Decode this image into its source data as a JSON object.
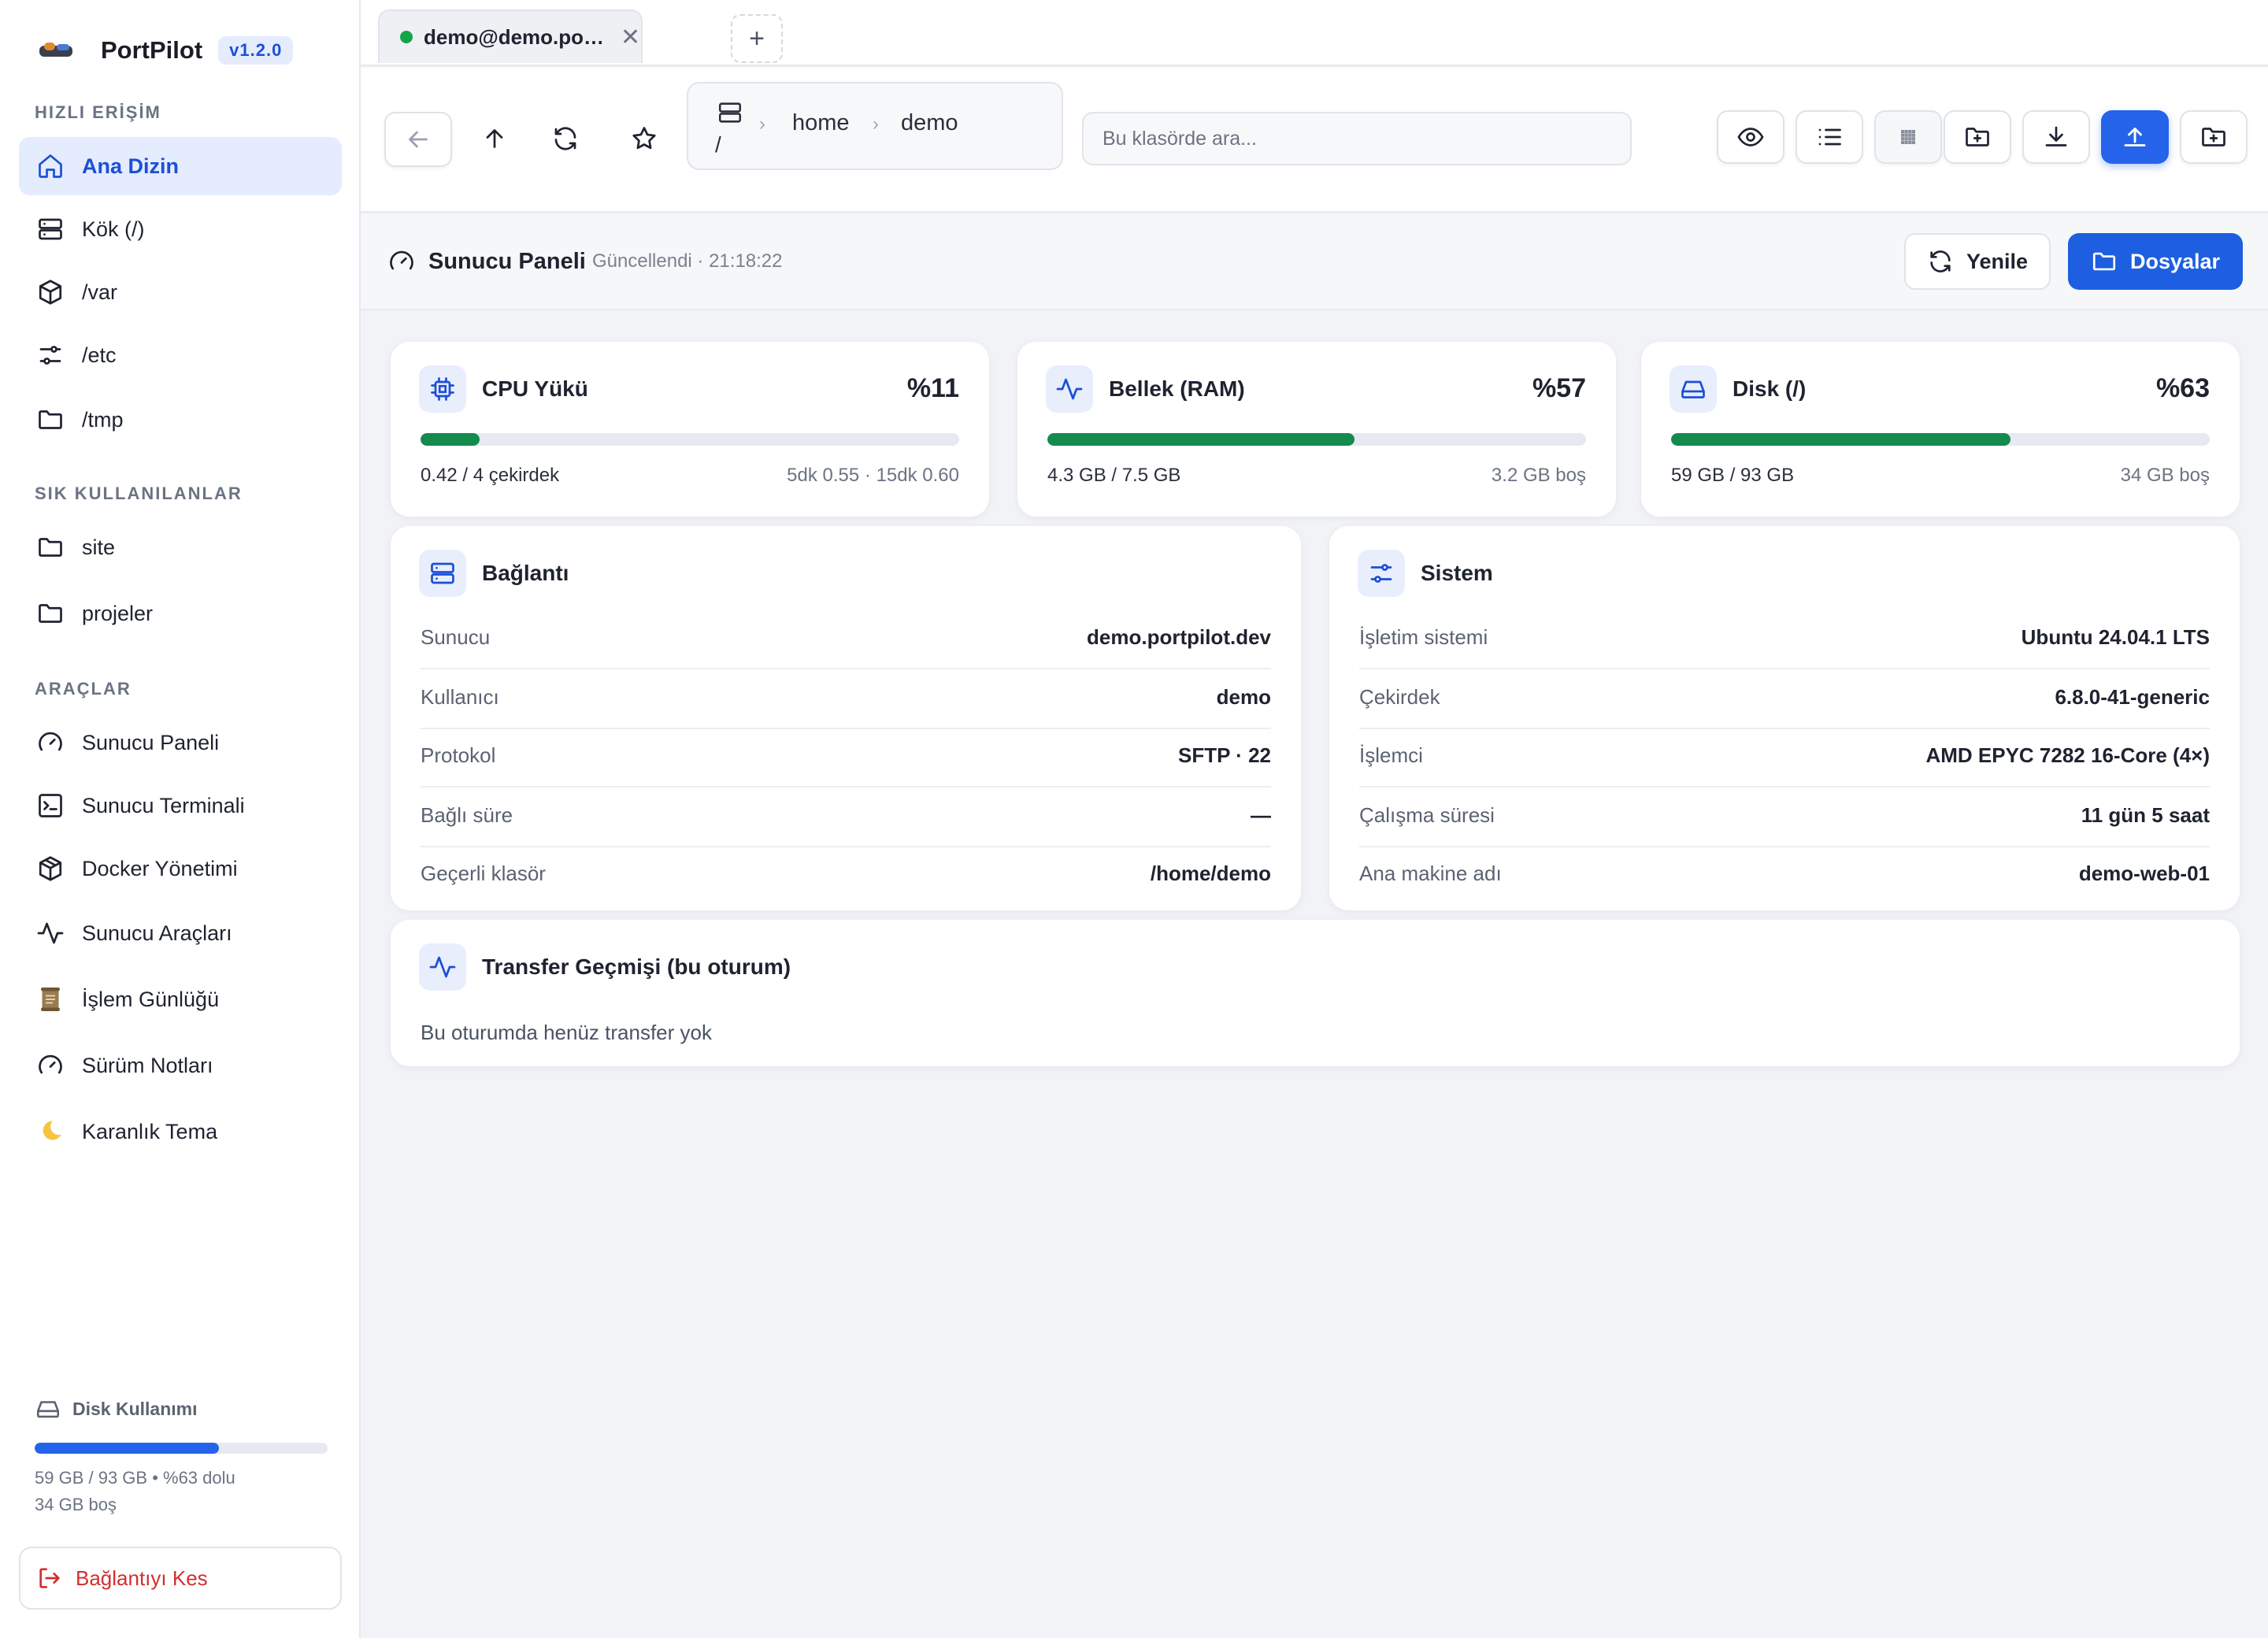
{
  "app": {
    "name": "PortPilot",
    "version": "v1.2.0"
  },
  "sidebar": {
    "quick_access_label": "HIZLI ERİŞİM",
    "quick_access": [
      {
        "label": "Ana Dizin",
        "icon": "home-icon",
        "active": true
      },
      {
        "label": "Kök (/)",
        "icon": "server-icon"
      },
      {
        "label": "/var",
        "icon": "box-icon"
      },
      {
        "label": "/etc",
        "icon": "sliders-icon"
      },
      {
        "label": "/tmp",
        "icon": "folder-icon"
      }
    ],
    "favorites_label": "SIK KULLANILANLAR",
    "favorites": [
      {
        "label": "site",
        "icon": "folder-icon"
      },
      {
        "label": "projeler",
        "icon": "folder-icon"
      }
    ],
    "tools_label": "ARAÇLAR",
    "tools": [
      {
        "label": "Sunucu Paneli",
        "icon": "gauge-icon"
      },
      {
        "label": "Sunucu Terminali",
        "icon": "terminal-icon"
      },
      {
        "label": "Docker Yönetimi",
        "icon": "package-icon"
      },
      {
        "label": "Sunucu Araçları",
        "icon": "activity-icon"
      },
      {
        "label": "İşlem Günlüğü",
        "icon": "scroll-icon"
      },
      {
        "label": "Sürüm Notları",
        "icon": "gauge-icon"
      },
      {
        "label": "Karanlık Tema",
        "icon": "moon-icon"
      }
    ],
    "disk": {
      "title": "Disk Kullanımı",
      "used_fraction": 0.63,
      "summary": "59 GB / 93 GB • %63 dolu",
      "free": "34 GB boş"
    },
    "disconnect_label": "Bağlantıyı Kes"
  },
  "tabs": [
    {
      "title": "demo@demo.portpilot.dev",
      "status": "connected"
    }
  ],
  "new_tab_label": "+",
  "toolbar": {
    "breadcrumb_root": "/",
    "breadcrumb": [
      "home",
      "demo"
    ],
    "search_placeholder": "Bu klasörde ara..."
  },
  "panel": {
    "title": "Sunucu Paneli",
    "updated": "Güncellendi · 21:18:22",
    "refresh_label": "Yenile",
    "files_label": "Dosyalar"
  },
  "metrics": [
    {
      "title": "CPU Yükü",
      "value": "%11",
      "fraction": 0.11,
      "left": "0.42 / 4 çekirdek",
      "right": "5dk 0.55 · 15dk 0.60",
      "icon": "cpu-icon"
    },
    {
      "title": "Bellek (RAM)",
      "value": "%57",
      "fraction": 0.57,
      "left": "4.3 GB / 7.5 GB",
      "right": "3.2 GB boş",
      "icon": "activity-icon"
    },
    {
      "title": "Disk (/)",
      "value": "%63",
      "fraction": 0.63,
      "left": "59 GB / 93 GB",
      "right": "34 GB boş",
      "icon": "hard-drive-icon"
    }
  ],
  "connection": {
    "title": "Bağlantı",
    "rows": [
      {
        "k": "Sunucu",
        "v": "demo.portpilot.dev"
      },
      {
        "k": "Kullanıcı",
        "v": "demo"
      },
      {
        "k": "Protokol",
        "v": "SFTP · 22"
      },
      {
        "k": "Bağlı süre",
        "v": "—"
      },
      {
        "k": "Geçerli klasör",
        "v": "/home/demo"
      }
    ]
  },
  "system": {
    "title": "Sistem",
    "rows": [
      {
        "k": "İşletim sistemi",
        "v": "Ubuntu 24.04.1 LTS"
      },
      {
        "k": "Çekirdek",
        "v": "6.8.0-41-generic"
      },
      {
        "k": "İşlemci",
        "v": "AMD EPYC 7282 16-Core (4×)"
      },
      {
        "k": "Çalışma süresi",
        "v": "11 gün 5 saat"
      },
      {
        "k": "Ana makine adı",
        "v": "demo-web-01"
      }
    ]
  },
  "transfers": {
    "title": "Transfer Geçmişi (bu oturum)",
    "empty": "Bu oturumda henüz transfer yok"
  },
  "colors": {
    "accent": "#2563eb",
    "success_bar": "#158a4e",
    "danger": "#d32f2f"
  }
}
